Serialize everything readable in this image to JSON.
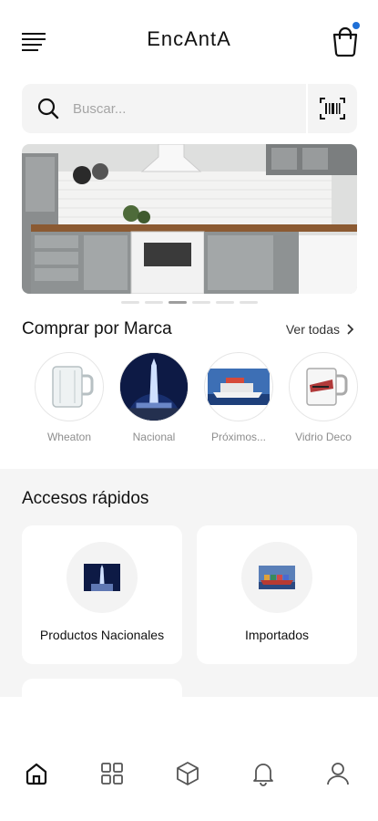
{
  "header": {
    "title": "EncAntA",
    "cart_badge_color": "#1f6fd6",
    "menu_icon": "menu-icon",
    "cart_icon": "shopping-bag-icon"
  },
  "search": {
    "placeholder": "Buscar...",
    "icon": "search-icon",
    "scan_icon": "barcode-scan-icon"
  },
  "banner": {
    "image": "kitchen-photo",
    "slides": 6,
    "active_slide": 3
  },
  "brands_section": {
    "title": "Comprar por Marca",
    "see_all": "Ver todas",
    "items": [
      {
        "label": "Wheaton",
        "image": "glass-mug"
      },
      {
        "label": "Nacional",
        "image": "obelisk-night"
      },
      {
        "label": "Próximos...",
        "image": "cruise-ship"
      },
      {
        "label": "Vidrio Deco",
        "image": "decorated-mug"
      }
    ]
  },
  "quick_access": {
    "title": "Accesos rápidos",
    "cards": [
      {
        "label": "Productos Nacionales",
        "image": "obelisk-night"
      },
      {
        "label": "Importados",
        "image": "cargo-ship"
      }
    ]
  },
  "bottom_nav": {
    "items": [
      {
        "icon": "home-icon",
        "active": true
      },
      {
        "icon": "grid-icon",
        "active": false
      },
      {
        "icon": "box-icon",
        "active": false
      },
      {
        "icon": "bell-icon",
        "active": false
      },
      {
        "icon": "user-icon",
        "active": false
      }
    ]
  }
}
